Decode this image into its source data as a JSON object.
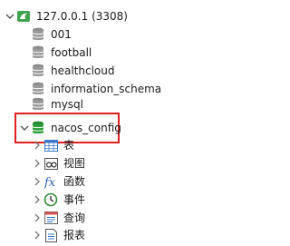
{
  "connection": {
    "label": "127.0.0.1  (3308)",
    "expanded": true,
    "icon": "mysql-dolphin-connection-icon"
  },
  "databases": [
    {
      "label": "001"
    },
    {
      "label": "football"
    },
    {
      "label": "healthcloud"
    },
    {
      "label": "information_schema"
    },
    {
      "label": "mysql"
    },
    {
      "label": "nacos_config",
      "active": true,
      "highlighted": true
    }
  ],
  "folders": [
    {
      "label": "表",
      "icon": "table-icon"
    },
    {
      "label": "视图",
      "icon": "view-icon"
    },
    {
      "label": "函数",
      "icon": "function-icon"
    },
    {
      "label": "事件",
      "icon": "event-clock-icon"
    },
    {
      "label": "查询",
      "icon": "query-icon"
    },
    {
      "label": "报表",
      "icon": "report-icon"
    }
  ],
  "colors": {
    "active_db": "#2e9e3a",
    "inactive_db": "#9a9a9a",
    "highlight_border": "#e02020"
  }
}
